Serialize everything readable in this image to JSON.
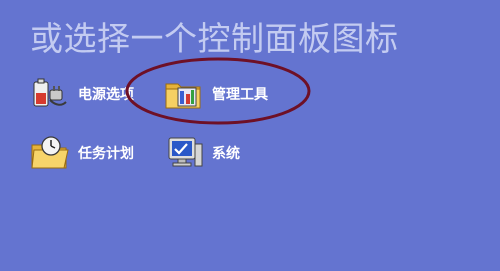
{
  "page": {
    "title": "或选择一个控制面板图标"
  },
  "items": [
    {
      "label": "电源选项",
      "icon": "power-options-icon"
    },
    {
      "label": "管理工具",
      "icon": "administrative-tools-icon"
    },
    {
      "label": "任务计划",
      "icon": "scheduled-tasks-icon"
    },
    {
      "label": "系统",
      "icon": "system-icon"
    }
  ],
  "colors": {
    "background": "#6474d0",
    "title": "#c3cbf1",
    "label": "#ffffff",
    "highlight_ellipse": "#6e1026"
  }
}
